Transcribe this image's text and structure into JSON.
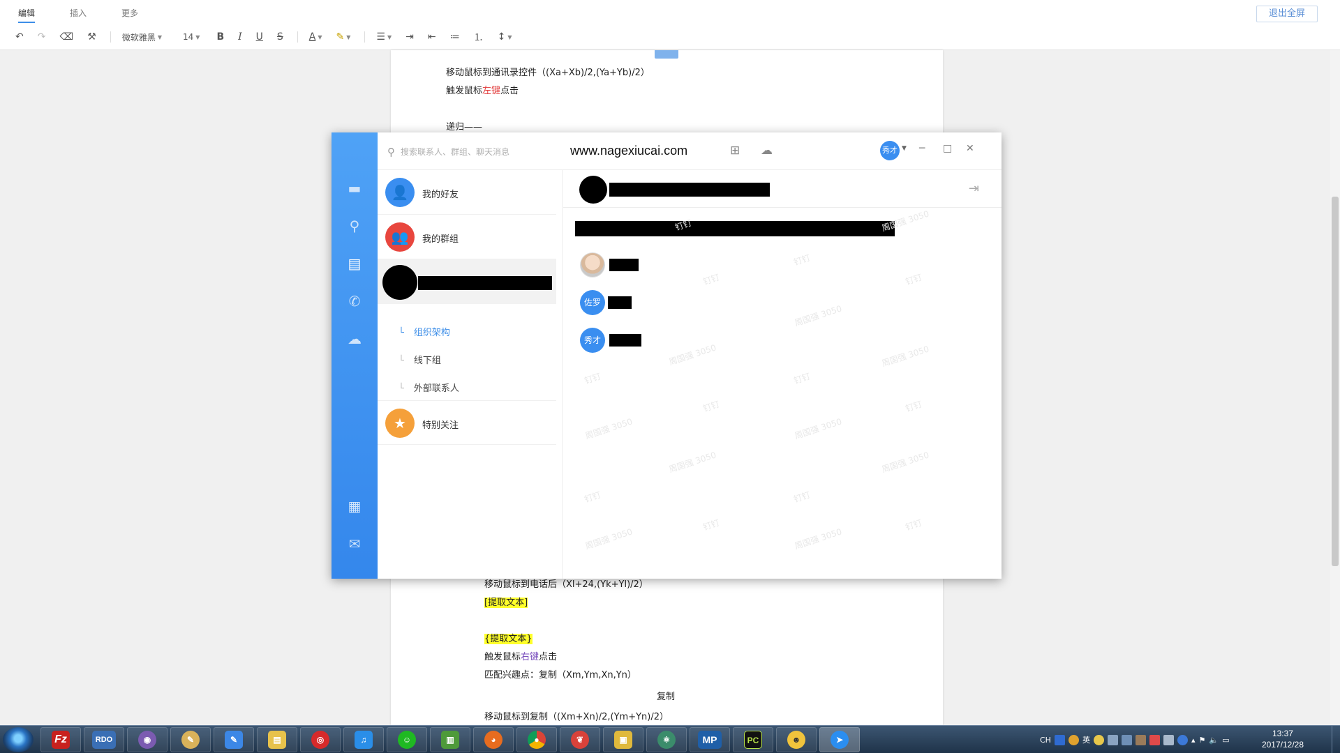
{
  "editor": {
    "tabs": [
      "编辑",
      "插入",
      "更多"
    ],
    "exit_fullscreen": "退出全屏",
    "font_name": "微软雅黑",
    "font_size": "14",
    "bold": "B",
    "italic": "I",
    "underline": "U",
    "strike": "S",
    "font_color": "A"
  },
  "doc": {
    "line1": "移动鼠标到通讯录控件（(Xa+Xb)/2,(Ya+Yb)/2）",
    "line2_pre": "触发鼠标",
    "line2_red": "左键",
    "line2_post": "点击",
    "line3": "递归——",
    "line4": "移动鼠标到电话后（Xl+24,(Yk+Yl)/2）",
    "line5": "[提取文本]",
    "line6": "{提取文本}",
    "line7_pre": "触发鼠标",
    "line7_purple": "右键",
    "line7_post": "点击",
    "line8": "匹配兴趣点：复制（Xm,Ym,Xn,Yn）",
    "line9": "复制",
    "line10": "移动鼠标到复制（(Xm+Xn)/2,(Ym+Yn)/2）"
  },
  "dingtalk": {
    "search_placeholder": "搜索联系人、群组、聊天消息",
    "url": "www.nagexiucai.com",
    "avatar_label": "秀才",
    "categories": [
      "我的好友",
      "我的群组",
      "特别关注"
    ],
    "sub_items": [
      "组织架构",
      "线下组",
      "外部联系人"
    ],
    "members": [
      "佐罗",
      "秀才"
    ],
    "watermark_a": "钉钉",
    "watermark_b": "周国强 3050"
  },
  "taskbar": {
    "rdo_label": "RDO",
    "mp_label": "MP",
    "pc_label": "PC",
    "tray_ch": "CH",
    "tray_lang": "英",
    "time": "13:37",
    "date": "2017/12/28"
  }
}
